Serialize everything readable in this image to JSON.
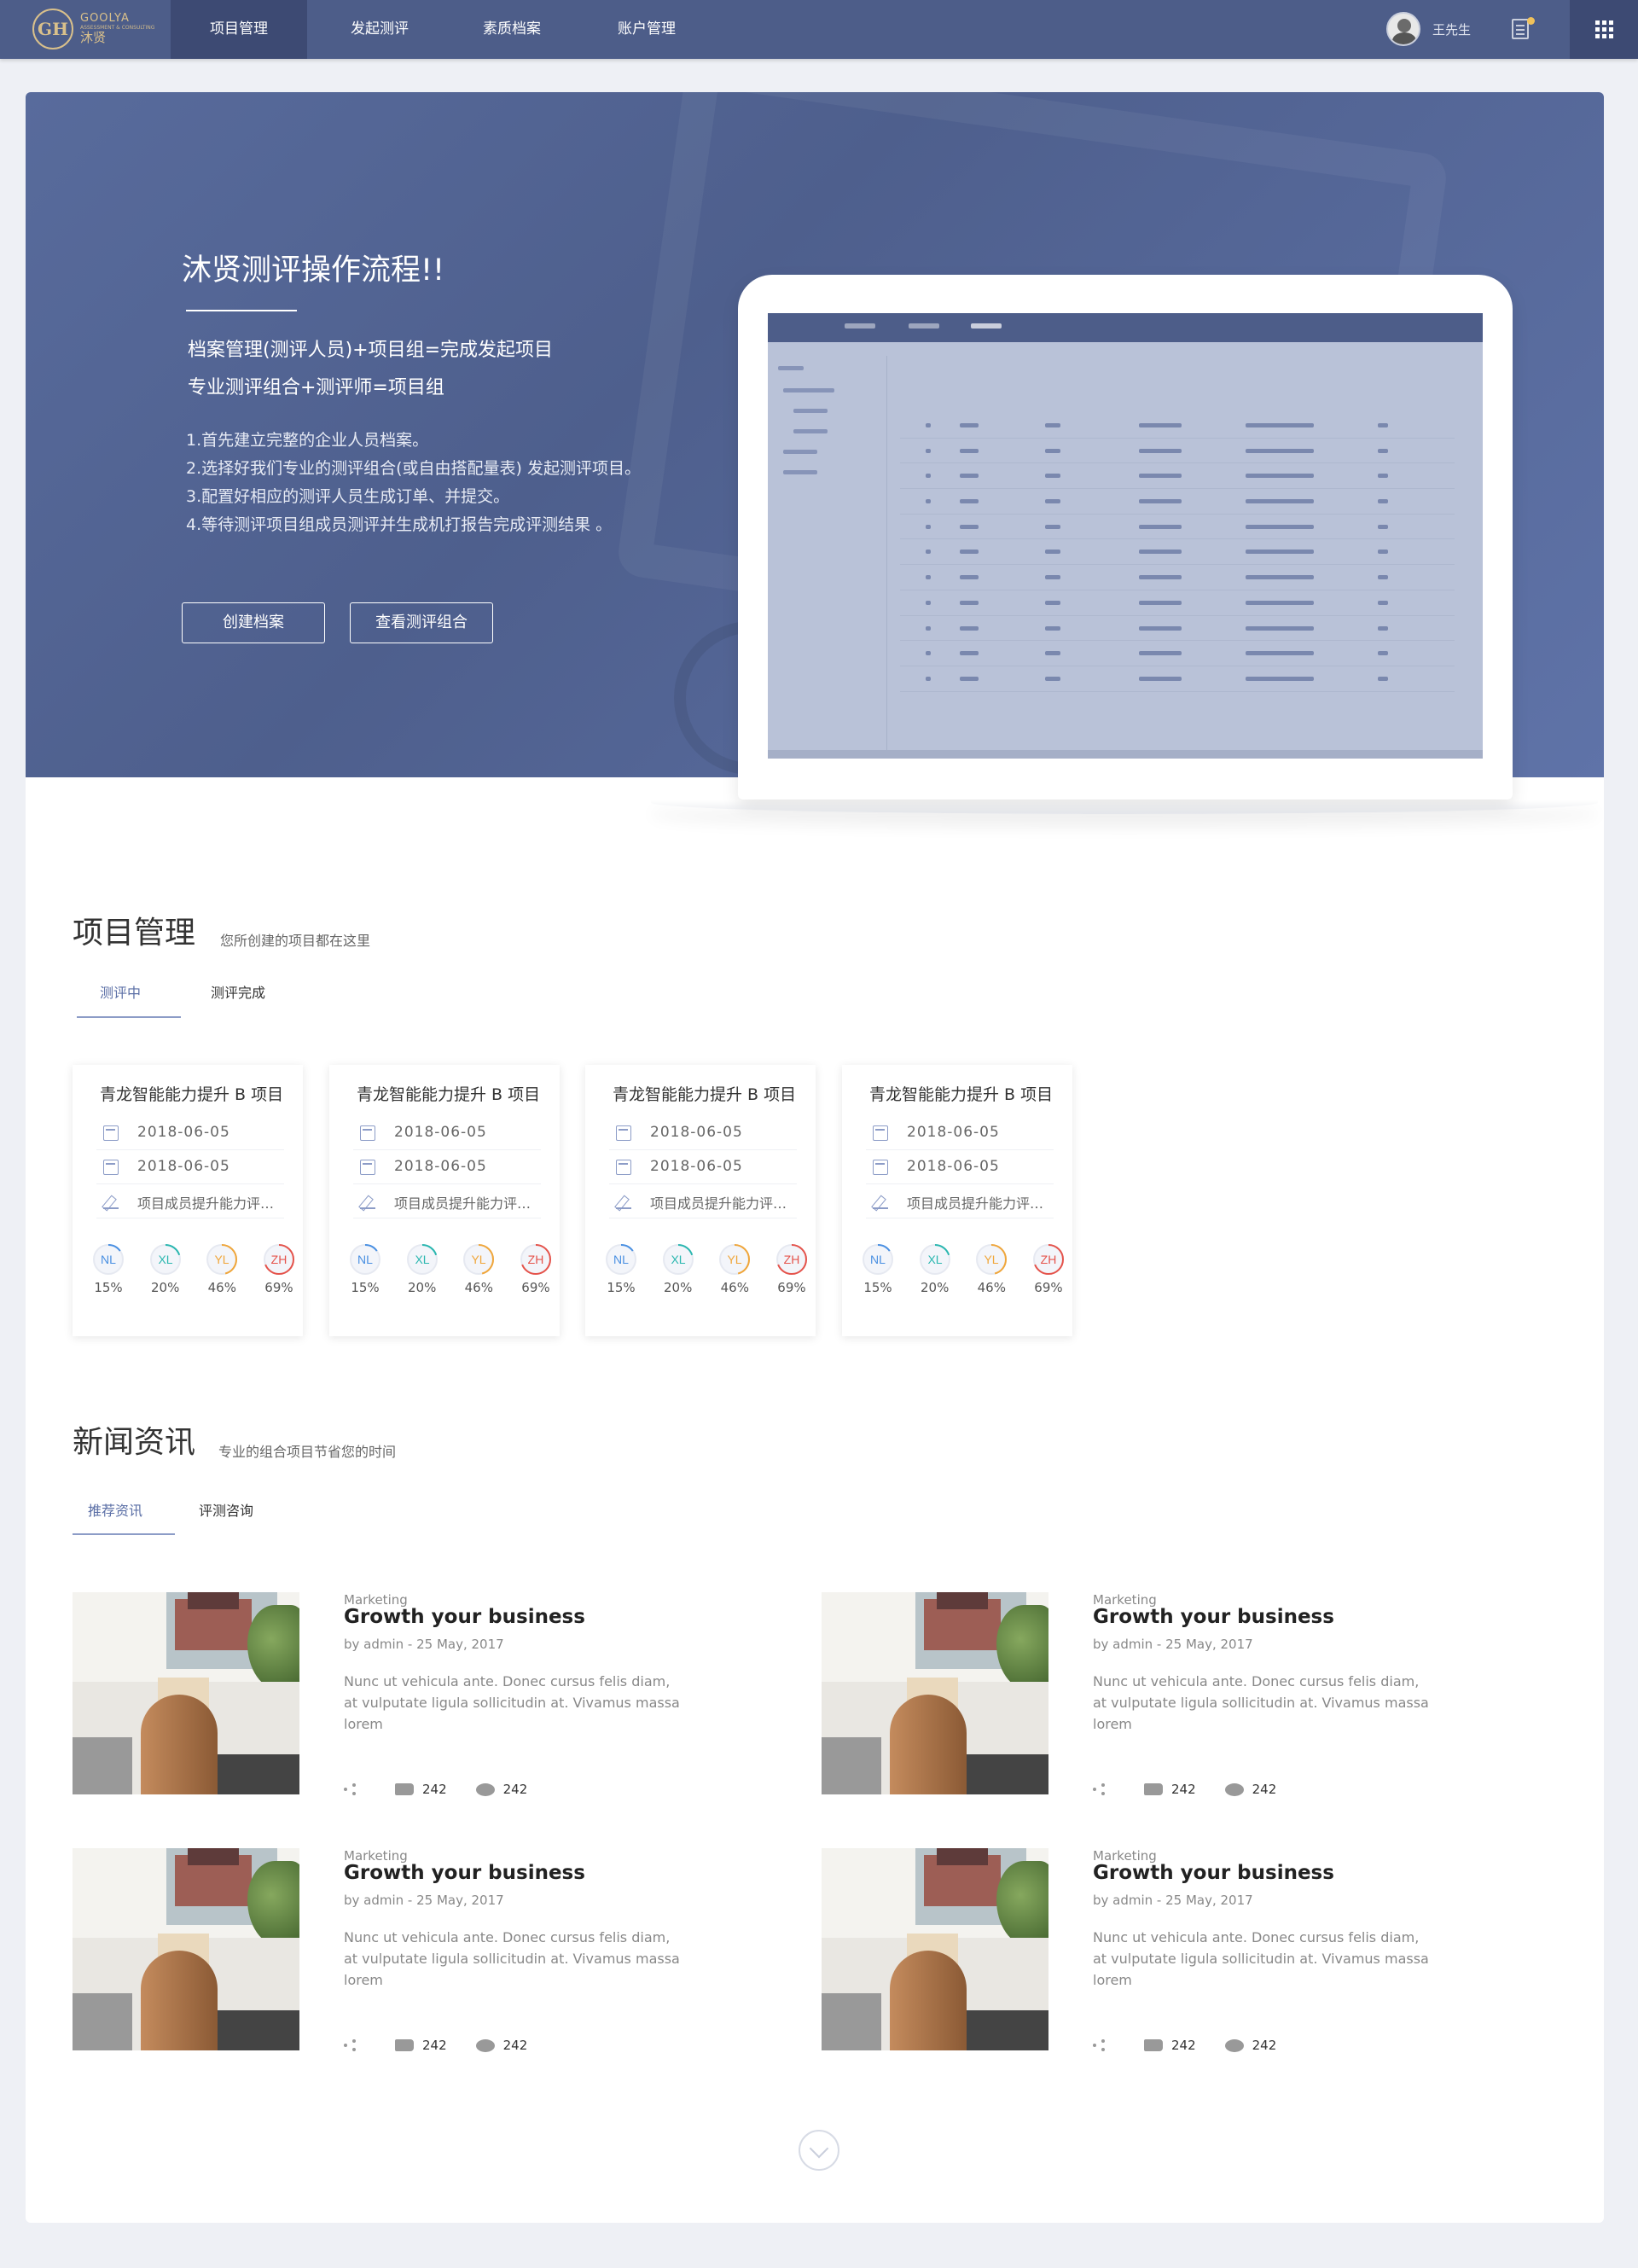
{
  "nav": {
    "logo_en": "GOOLYA",
    "logo_sub": "ASSESSMENT & CONSULTING",
    "logo_cn": "沐贤",
    "items": [
      {
        "label": "项目管理",
        "active": true
      },
      {
        "label": "发起测评",
        "active": false
      },
      {
        "label": "素质档案",
        "active": false
      },
      {
        "label": "账户管理",
        "active": false
      }
    ],
    "user_name": "王先生"
  },
  "hero": {
    "title": "沐贤测评操作流程!!",
    "formula1": "档案管理(测评人员)+项目组=完成发起项目",
    "formula2": "专业测评组合+测评师=项目组",
    "steps": [
      "1.首先建立完整的企业人员档案。",
      "2.选择好我们专业的测评组合(或自由搭配量表) 发起测评项目。",
      "3.配置好相应的测评人员生成订单、并提交。",
      "4.等待测评项目组成员测评并生成机打报告完成评测结果  。"
    ],
    "btn_create": "创建档案",
    "btn_view": "查看测评组合"
  },
  "projects": {
    "title": "项目管理",
    "desc": "您所创建的项目都在这里",
    "tabs": [
      "测评中",
      "测评完成"
    ],
    "cards": [
      {
        "title": "青龙智能能力提升 B 项目",
        "start": "2018-06-05",
        "end": "2018-06-05",
        "desc": "项目成员提升能力评测 ...",
        "rings": [
          {
            "code": "NL",
            "pct": "15%",
            "value": 15
          },
          {
            "code": "XL",
            "pct": "20%",
            "value": 20
          },
          {
            "code": "YL",
            "pct": "46%",
            "value": 46
          },
          {
            "code": "ZH",
            "pct": "69%",
            "value": 69
          }
        ]
      },
      {
        "title": "青龙智能能力提升 B 项目",
        "start": "2018-06-05",
        "end": "2018-06-05",
        "desc": "项目成员提升能力评测 ...",
        "rings": [
          {
            "code": "NL",
            "pct": "15%",
            "value": 15
          },
          {
            "code": "XL",
            "pct": "20%",
            "value": 20
          },
          {
            "code": "YL",
            "pct": "46%",
            "value": 46
          },
          {
            "code": "ZH",
            "pct": "69%",
            "value": 69
          }
        ]
      },
      {
        "title": "青龙智能能力提升 B 项目",
        "start": "2018-06-05",
        "end": "2018-06-05",
        "desc": "项目成员提升能力评测 ...",
        "rings": [
          {
            "code": "NL",
            "pct": "15%",
            "value": 15
          },
          {
            "code": "XL",
            "pct": "20%",
            "value": 20
          },
          {
            "code": "YL",
            "pct": "46%",
            "value": 46
          },
          {
            "code": "ZH",
            "pct": "69%",
            "value": 69
          }
        ]
      },
      {
        "title": "青龙智能能力提升 B 项目",
        "start": "2018-06-05",
        "end": "2018-06-05",
        "desc": "项目成员提升能力评测 ...",
        "rings": [
          {
            "code": "NL",
            "pct": "15%",
            "value": 15
          },
          {
            "code": "XL",
            "pct": "20%",
            "value": 20
          },
          {
            "code": "YL",
            "pct": "46%",
            "value": 46
          },
          {
            "code": "ZH",
            "pct": "69%",
            "value": 69
          }
        ]
      }
    ]
  },
  "news": {
    "title": "新闻资讯",
    "desc": "专业的组合项目节省您的时间",
    "tabs": [
      "推荐资讯",
      "评测咨询"
    ],
    "items": [
      {
        "category": "Marketing",
        "title": "Growth your business",
        "byline": "by admin - 25 May, 2017",
        "body": "Nunc ut vehicula ante. Donec cursus felis diam, at vulputate ligula sollicitudin at. Vivamus massa lorem",
        "likes": "242",
        "comments": "242"
      },
      {
        "category": "Marketing",
        "title": "Growth your business",
        "byline": "by admin - 25 May, 2017",
        "body": "Nunc ut vehicula ante. Donec cursus felis diam, at vulputate ligula sollicitudin at. Vivamus massa lorem",
        "likes": "242",
        "comments": "242"
      },
      {
        "category": "Marketing",
        "title": "Growth your business",
        "byline": "by admin - 25 May, 2017",
        "body": "Nunc ut vehicula ante. Donec cursus felis diam, at vulputate ligula sollicitudin at. Vivamus massa lorem",
        "likes": "242",
        "comments": "242"
      },
      {
        "category": "Marketing",
        "title": "Growth your business",
        "byline": "by admin - 25 May, 2017",
        "body": "Nunc ut vehicula ante. Donec cursus felis diam, at vulputate ligula sollicitudin at. Vivamus massa lorem",
        "likes": "242",
        "comments": "242"
      }
    ]
  },
  "icons": {
    "calendar_start": "calendar-icon",
    "calendar_end": "calendar-check-icon",
    "edit": "pen-icon",
    "share": "share-icon",
    "like": "thumbs-up-icon",
    "comment": "comment-icon",
    "more": "chevron-down-circle-icon",
    "apps": "grid-icon",
    "notice": "document-icon"
  },
  "colors": {
    "nav_bg": "#4d5d89",
    "nav_active": "#3d4a73",
    "accent": "#5b6fa6",
    "logo_gold": "#d9c08b",
    "ring_nl": "#4a90e2",
    "ring_xl": "#2bb7b0",
    "ring_yl": "#f0a63a",
    "ring_zh": "#e5534b"
  }
}
